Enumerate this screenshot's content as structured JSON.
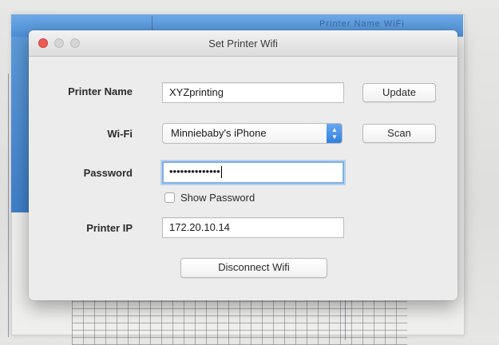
{
  "background": {
    "app_title_fragment": "Printer Name WiFi"
  },
  "dialog": {
    "title": "Set Printer Wifi",
    "printer_name": {
      "label": "Printer Name",
      "value": "XYZprinting",
      "button": "Update"
    },
    "wifi": {
      "label": "Wi-Fi",
      "selected": "Minniebaby's iPhone",
      "button": "Scan"
    },
    "password": {
      "label": "Password",
      "value_masked": "••••••••••••••"
    },
    "show_password": {
      "label": "Show Password",
      "checked": false
    },
    "printer_ip": {
      "label": "Printer IP",
      "value": "172.20.10.14"
    },
    "disconnect_button": "Disconnect Wifi"
  },
  "colors": {
    "close_button": "#ec5b57",
    "focus_ring": "#7cb0e9",
    "popup_accent": "#2f7fe0",
    "background_window_titlebar": "#4c8fd6"
  }
}
